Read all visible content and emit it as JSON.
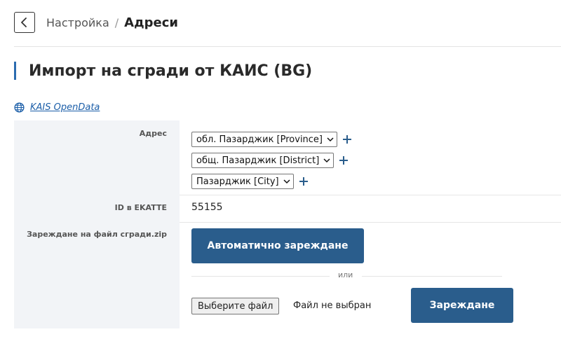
{
  "header": {
    "back_icon": "chevron-left-icon",
    "breadcrumb_parent": "Настройка",
    "breadcrumb_separator": "/",
    "breadcrumb_current": "Адреси"
  },
  "page": {
    "title": "Импорт на сгради от КАИС (BG)",
    "accent_color": "#2b6cb0"
  },
  "source_link": {
    "icon": "globe-icon",
    "label": "KAIS OpenData",
    "color": "#1b5ea8"
  },
  "form": {
    "address": {
      "label": "Адрес",
      "selects": [
        {
          "value": "обл. Пазарджик [Province]"
        },
        {
          "value": "общ. Пазарджик [District]"
        },
        {
          "value": "Пазарджик [City]"
        }
      ],
      "add_icon": "plus-icon"
    },
    "ekatte": {
      "label": "ID в EKATTE",
      "value": "55155"
    },
    "upload": {
      "label": "Зареждане на файл сгради.zip",
      "auto_button": "Автоматично зареждане",
      "or_text": "или",
      "file_button": "Выберите файл",
      "file_status": "Файл не выбран",
      "upload_button": "Зареждане",
      "button_color": "#2a5d8c"
    }
  }
}
